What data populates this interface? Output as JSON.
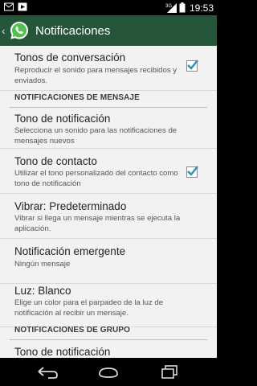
{
  "status_bar": {
    "network": "3G",
    "time": "19:53"
  },
  "action_bar": {
    "title": "Notificaciones",
    "logo_icon": "whatsapp-logo-icon"
  },
  "rows": {
    "conversation_tones": {
      "title": "Tonos de conversación",
      "summary": "Reproducir el sonido para mensajes recibidos y enviados.",
      "checked": true
    },
    "msg_header": "NOTIFICACIONES DE MENSAJE",
    "msg_tone": {
      "title": "Tono de notificación",
      "summary": "Selecciona un sonido para las notificaciones de mensajes nuevos"
    },
    "contact_tone": {
      "title": "Tono de contacto",
      "summary": "Utilizar el tono personalizado del contacto como tono de notificación",
      "checked": true
    },
    "vibrate": {
      "title": "Vibrar: Predeterminado",
      "summary": "Vibrar si llega un mensaje mientras se ejecuta la aplicación."
    },
    "popup": {
      "title": "Notificación emergente",
      "summary": "Ningún mensaje"
    },
    "light": {
      "title": "Luz: Blanco",
      "summary": "Elige un color para el parpadeo de la luz de notificación al recibir un mensaje."
    },
    "group_header": "NOTIFICACIONES DE GRUPO",
    "group_tone": {
      "title": "Tono de notificación"
    }
  },
  "colors": {
    "action_bar": "#26563a",
    "check_accent": "#2e8fb5",
    "background": "#f2f2f2"
  }
}
